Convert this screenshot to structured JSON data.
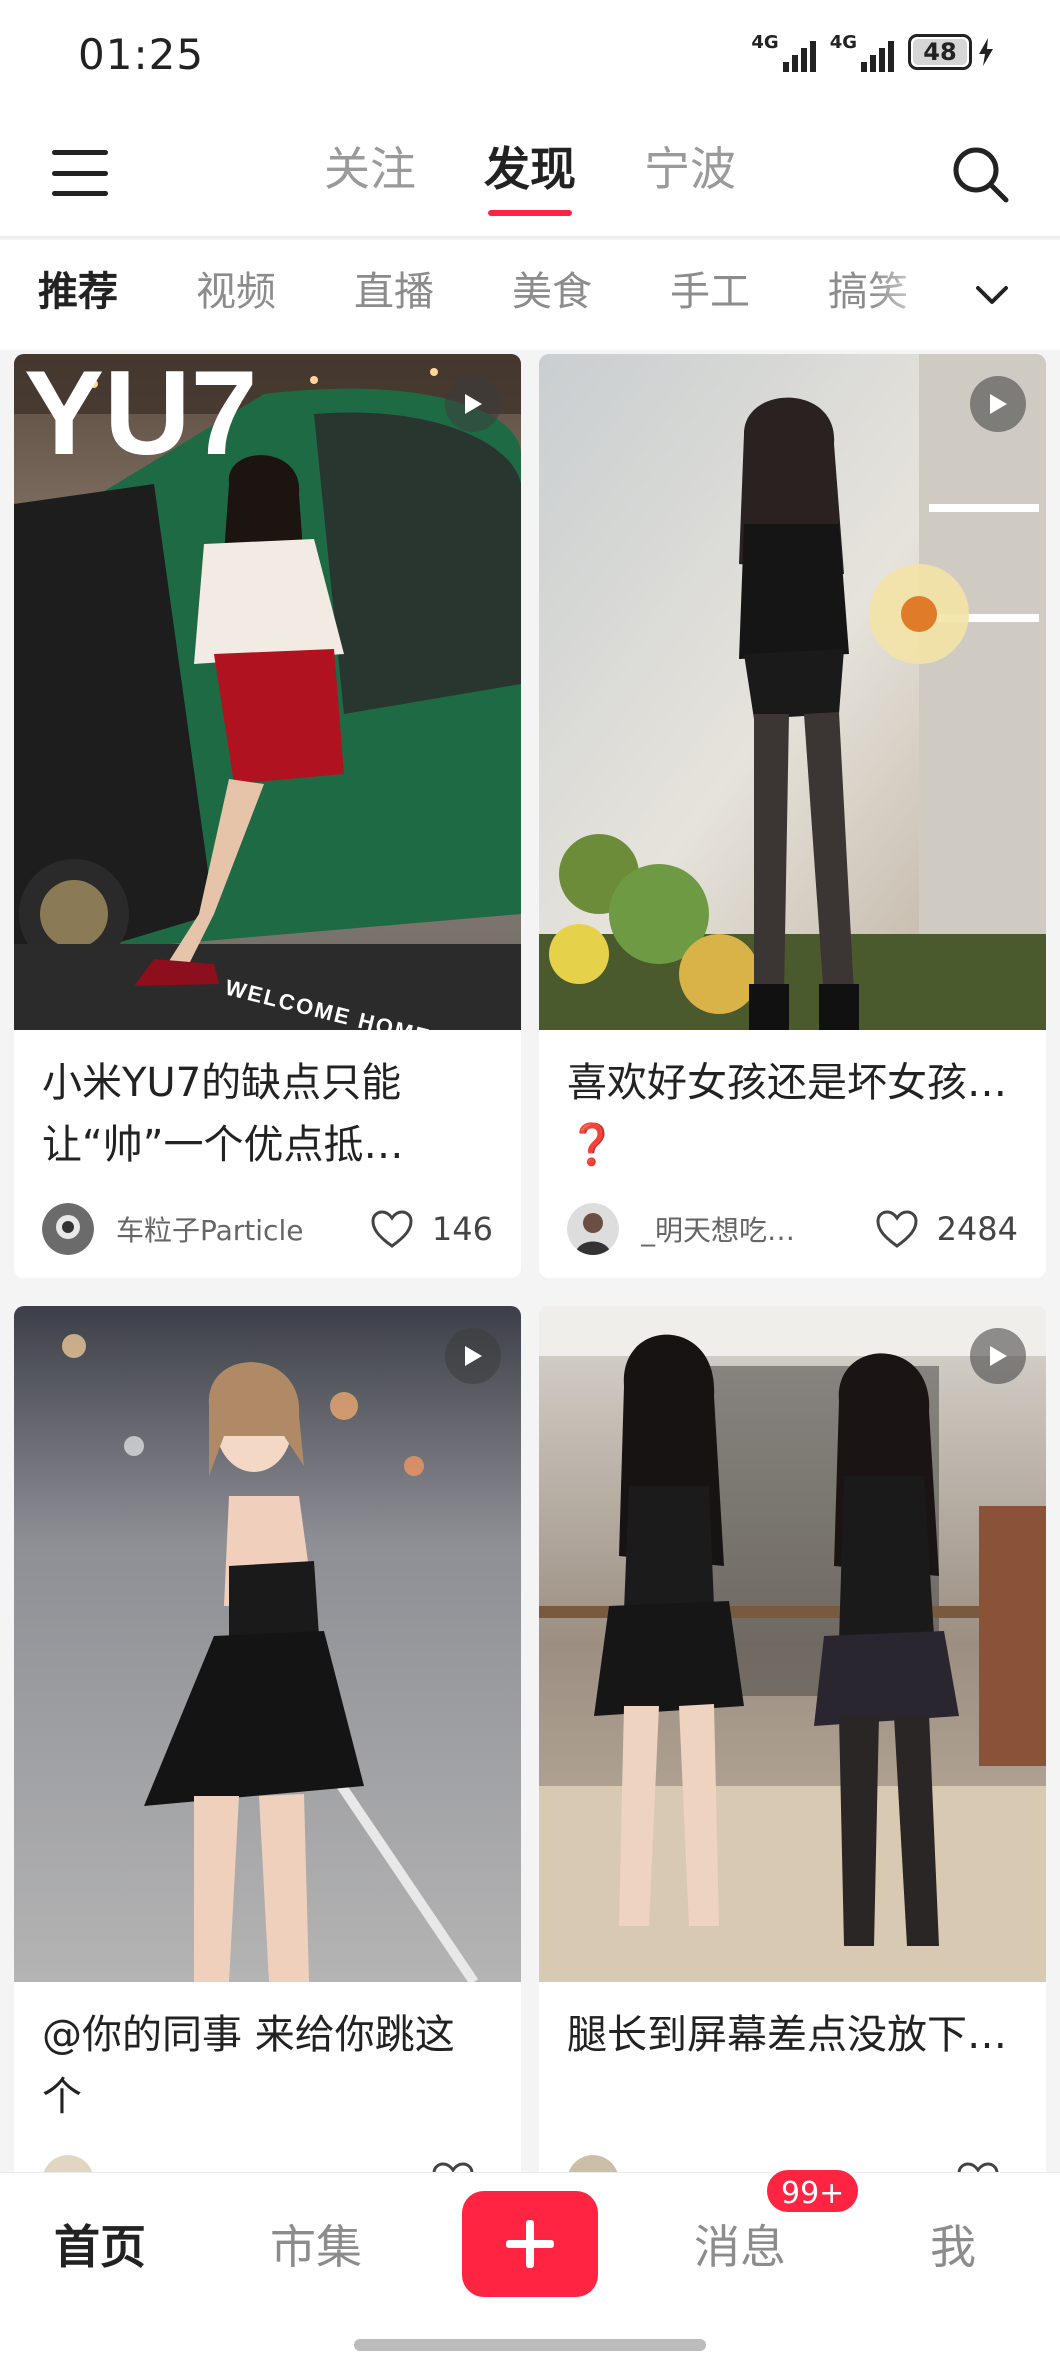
{
  "status_bar": {
    "time": "01:25",
    "network_1": "4G",
    "network_2": "4G",
    "battery": "48"
  },
  "top_nav": {
    "tabs": [
      {
        "label": "关注",
        "active": false
      },
      {
        "label": "发现",
        "active": true
      },
      {
        "label": "宁波",
        "active": false
      }
    ]
  },
  "categories": {
    "items": [
      "推荐",
      "视频",
      "直播",
      "美食",
      "手工",
      "搞笑"
    ],
    "active": "推荐"
  },
  "feed": {
    "cards": [
      {
        "title": "小米YU7的缺点只能让“帅”一个优点抵…",
        "author": "车粒子Particle",
        "likes": "146",
        "has_video": true,
        "cover_text": "YU7",
        "cover_sub": "WELCOME HOME"
      },
      {
        "title": "喜欢好女孩还是坏女孩…❓",
        "author": "_明天想吃…",
        "likes": "2484",
        "has_video": true
      },
      {
        "title": "@你的同事 来给你跳这个",
        "author": "",
        "likes": "",
        "has_video": true
      },
      {
        "title": "腿长到屏幕差点没放下…",
        "author": "",
        "likes": "",
        "has_video": true
      }
    ]
  },
  "bottom_bar": {
    "home": "首页",
    "market": "市集",
    "messages": "消息",
    "messages_badge": "99+",
    "me": "我"
  },
  "colors": {
    "accent": "#ff2442",
    "text_primary": "#222222",
    "text_secondary": "#8c8c8c"
  }
}
